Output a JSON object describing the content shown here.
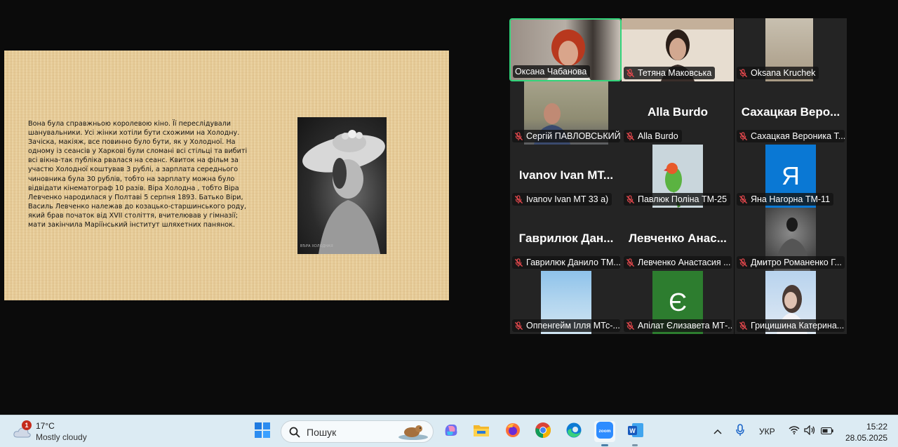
{
  "slide": {
    "text": "Вона була справжньою королевою кіно. Її переслідували шанувальники. Усі жінки хотіли  бути схожими на Холодну. Зачіска, макіяж, все повинно було бути, як у Холодної. На одному із сеансів у Харкові були сломані всі стільці та вибиті всі вікна-так публіка рвалася на сеанс. Квиток на фільм за участю Холодної коштував 3 рублі, а зарплата середнього чиновника була 30 рублів, тобто на зарплату можна було відвідати кінематограф 10 разів. Віра Холодна , тобто Віра Левченко народилася у Полтаві  5 серпня 1893. Батько Віри, Василь Левченко належав до козацько-старшинського роду, який брав початок від XVII століття, вчителював у гімназії; мати закінчила Маріїнський інститут шляхетних панянок.",
    "photo_caption": "ВѢРА ХОЛОДНАЯ"
  },
  "participants": [
    {
      "label": "Оксана Чабанова",
      "big": "",
      "muted": false,
      "active": true,
      "kind": "video-woman-red"
    },
    {
      "label": "Тетяна Маковська",
      "big": "",
      "muted": true,
      "active": false,
      "kind": "video-woman-dark"
    },
    {
      "label": "Oksana Kruchek",
      "big": "",
      "muted": true,
      "active": false,
      "kind": "video-blur"
    },
    {
      "label": "Сергій ПАВЛОВСЬКИЙ",
      "big": "",
      "muted": true,
      "active": false,
      "kind": "video-man"
    },
    {
      "label": "Alla Burdo",
      "big": "Alla Burdo",
      "muted": true,
      "active": false,
      "kind": "name"
    },
    {
      "label": "Сахацкая Вероника Т...",
      "big": "Сахацкая  Веро...",
      "muted": true,
      "active": false,
      "kind": "name"
    },
    {
      "label": "Ivanov Ivan MT 33 a)",
      "big": "Ivanov  Ivan  MT...",
      "muted": true,
      "active": false,
      "kind": "name"
    },
    {
      "label": "Павлюк Поліна ТМ-25",
      "big": "",
      "muted": true,
      "active": false,
      "kind": "avatar-parrot"
    },
    {
      "label": "Яна Нагорна ТМ-11",
      "big": "",
      "muted": true,
      "active": false,
      "kind": "avatar-letter",
      "letter": "Я",
      "color": "#0a78d4"
    },
    {
      "label": "Гаврилюк Данило ТМ...",
      "big": "Гаврилюк  Дан...",
      "muted": true,
      "active": false,
      "kind": "name"
    },
    {
      "label": "Левченко Анастасия ...",
      "big": "Левченко  Анас...",
      "muted": true,
      "active": false,
      "kind": "name"
    },
    {
      "label": "Дмитро Романенко Г...",
      "big": "",
      "muted": true,
      "active": false,
      "kind": "avatar-bw"
    },
    {
      "label": "Оппенгейм Ілля МТс-...",
      "big": "",
      "muted": true,
      "active": false,
      "kind": "avatar-sky"
    },
    {
      "label": "Апілат Єлизавета МТ-...",
      "big": "",
      "muted": true,
      "active": false,
      "kind": "avatar-letter",
      "letter": "Є",
      "color": "#2d7d2f"
    },
    {
      "label": "Грицишина Катерина...",
      "big": "",
      "muted": true,
      "active": false,
      "kind": "avatar-girl"
    }
  ],
  "taskbar": {
    "weather_badge": "1",
    "temperature": "17°C",
    "condition": "Mostly cloudy",
    "search_placeholder": "Пошук",
    "language": "УКР",
    "time": "15:22",
    "date": "28.05.2025",
    "apps": [
      "start-icon",
      "copilot-icon",
      "file-explorer-icon",
      "firefox-icon",
      "chrome-icon",
      "edge-icon",
      "zoom-icon",
      "word-icon"
    ],
    "tray": [
      "chevron-up-icon",
      "microphone-icon",
      "wifi-icon",
      "volume-icon",
      "battery-icon"
    ]
  }
}
